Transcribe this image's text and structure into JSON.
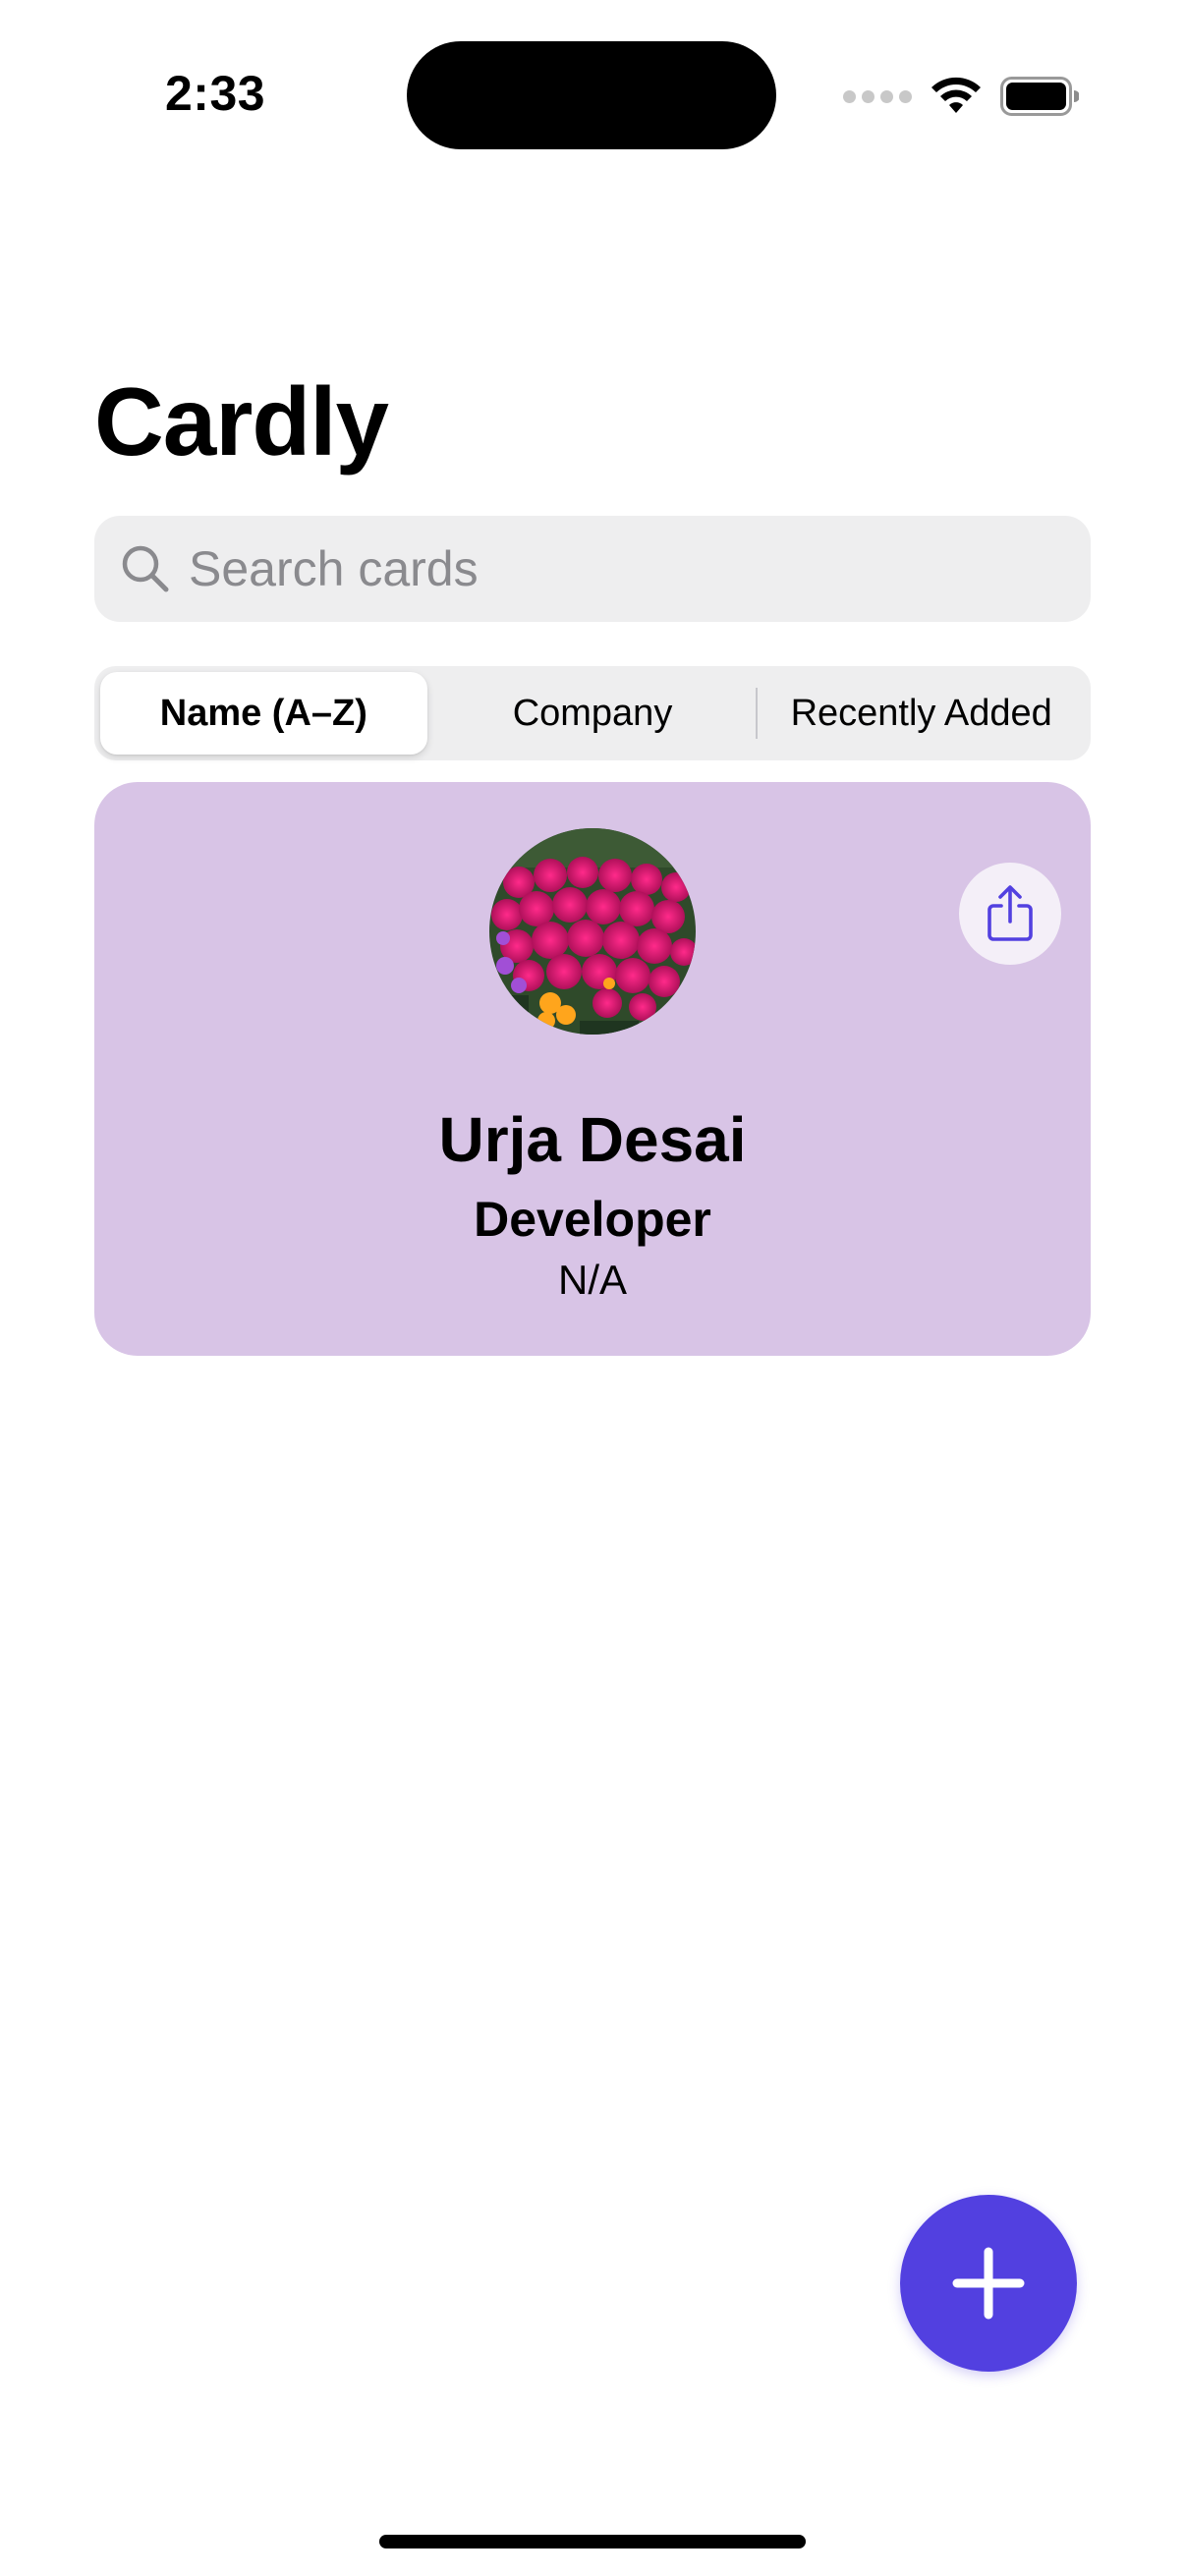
{
  "status_bar": {
    "time": "2:33"
  },
  "app": {
    "title": "Cardly"
  },
  "search": {
    "placeholder": "Search cards",
    "value": ""
  },
  "sort_segments": [
    {
      "label": "Name (A–Z)",
      "selected": true
    },
    {
      "label": "Company",
      "selected": false
    },
    {
      "label": "Recently Added",
      "selected": false
    }
  ],
  "cards": [
    {
      "name": "Urja Desai",
      "title": "Developer",
      "company": "N/A",
      "background_color": "#d8c4e6"
    }
  ],
  "colors": {
    "accent": "#5240e0",
    "card_background": "#d8c4e6",
    "search_background": "#eeeeef"
  },
  "icons": {
    "search": "search-icon",
    "share": "share-icon",
    "add": "plus-icon",
    "wifi": "wifi-icon",
    "battery": "battery-icon"
  }
}
